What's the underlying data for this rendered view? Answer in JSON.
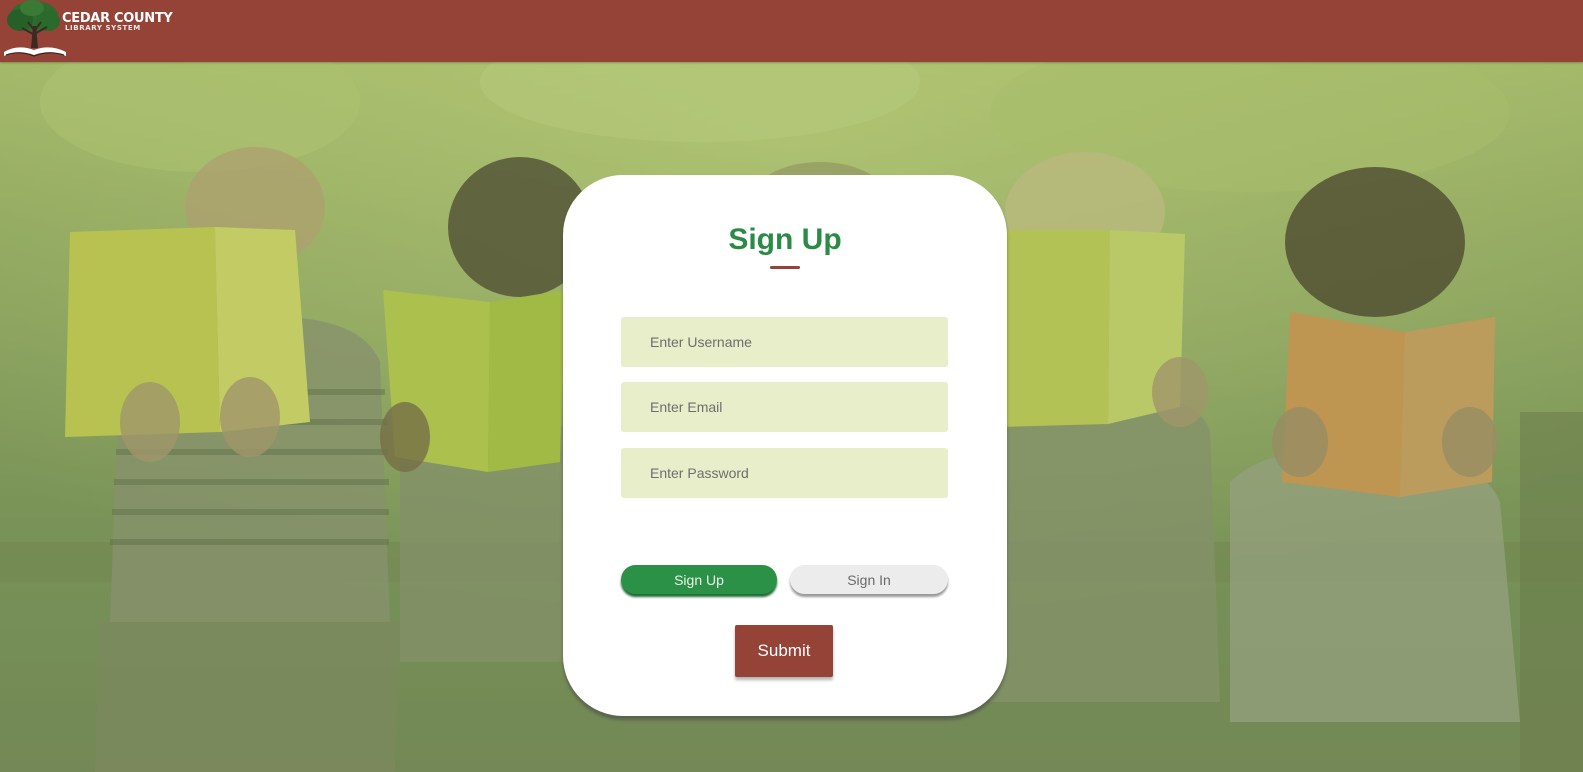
{
  "header": {
    "logo_title": "CEDAR COUNTY",
    "logo_subtitle": "LIBRARY SYSTEM"
  },
  "form": {
    "title": "Sign Up",
    "username_placeholder": "Enter Username",
    "email_placeholder": "Enter Email",
    "password_placeholder": "Enter Password",
    "signup_label": "Sign Up",
    "signin_label": "Sign In",
    "submit_label": "Submit"
  },
  "colors": {
    "header_bg": "#954237",
    "accent_green": "#2a8a46",
    "field_bg": "#e8eeca",
    "submit_bg": "#954237"
  }
}
